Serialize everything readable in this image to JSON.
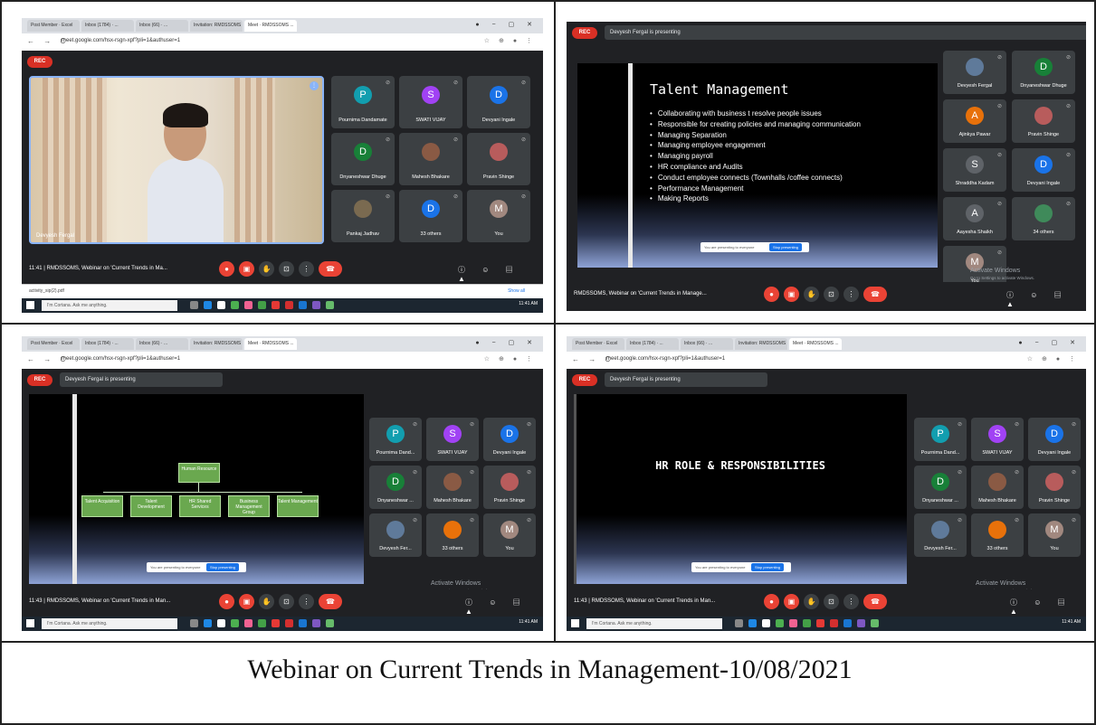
{
  "caption": "Webinar on Current Trends in Management-10/08/2021",
  "colors": {
    "rec": "#d93025",
    "tile_bg": "#3c4043",
    "meet_bg": "#202124",
    "org_box": "#6aa84f"
  },
  "browser": {
    "tabs": [
      "Post Member · Excel",
      "Inbox (1784) · ...",
      "Inbox (66) · ...",
      "Invitation: RMDSSOMS ...",
      "Meet · RMDSSOMS ..."
    ],
    "url": "meet.google.com/hsx-rsgn-xpf?pli=1&authuser=1"
  },
  "meet": {
    "rec_label": "REC",
    "presenting": "Devyesh Fergal is presenting",
    "meeting_title": "RMDSSOMS, Webinar on 'Current Trends in Manage...",
    "meeting_title_short": "RMDSSOMS, Webinar on 'Current Trends in Man...",
    "meeting_title_first": "RMDSSOMS, Webinar on 'Current Trends in Ma...",
    "time": "11:41",
    "time2": "11:43",
    "watermark_title": "Activate Windows",
    "watermark_sub": "Go to Settings to activate Windows.",
    "speaker_name": "Devyesh Fergal"
  },
  "panel1": {
    "participants": [
      {
        "initial": "P",
        "name": "Pournima Dandamate",
        "color": "#129eaf"
      },
      {
        "initial": "S",
        "name": "SWATI VIJAY",
        "color": "#a142f4"
      },
      {
        "initial": "D",
        "name": "Devyani Ingale",
        "color": "#1a73e8"
      },
      {
        "initial": "D",
        "name": "Dnyaneshwar Dhuge",
        "color": "#188038"
      },
      {
        "initial": "",
        "name": "Mahesh Bhakare",
        "color": "#8a5a44"
      },
      {
        "initial": "",
        "name": "Pravin Shinge",
        "color": "#b85c5c"
      },
      {
        "initial": "",
        "name": "Pankaj Jadhav",
        "color": "#7a6a50"
      },
      {
        "initial": "D",
        "name": "33 others",
        "color": "#1a73e8"
      },
      {
        "initial": "M",
        "name": "You",
        "color": "#a1887f"
      }
    ],
    "download_file": "activity_sip(2).pdf",
    "show_all": "Show all",
    "taskbar_search": "I'm Cortana. Ask me anything.",
    "tray_time": "11:41 AM"
  },
  "panel2": {
    "slide_title": "Talent Management",
    "bullets": [
      "Collaborating with business t resolve people issues",
      "Responsible for creating policies and managing communication",
      "Managing Separation",
      "Managing employee engagement",
      "Managing payroll",
      "HR compliance and Audits",
      "Conduct employee connects (Townhalls /coffee connects)",
      "Performance Management",
      "Making Reports"
    ],
    "stop_presenting_text": "You are presenting to everyone",
    "stop_button": "Stop presenting",
    "participants": [
      {
        "initial": "",
        "name": "Devyesh Fergal",
        "color": "#5f7a9a"
      },
      {
        "initial": "D",
        "name": "Dnyaneshwar Dhuge",
        "color": "#188038"
      },
      {
        "initial": "A",
        "name": "Ajinkya Pawar",
        "color": "#e8710a"
      },
      {
        "initial": "",
        "name": "Pravin Shinge",
        "color": "#b85c5c"
      },
      {
        "initial": "S",
        "name": "Shraddha Kadam",
        "color": "#5f6368"
      },
      {
        "initial": "D",
        "name": "Devyani Ingale",
        "color": "#1a73e8"
      },
      {
        "initial": "A",
        "name": "Aayesha Shaikh",
        "color": "#5f6368"
      },
      {
        "initial": "",
        "name": "34 others",
        "color": "#3f8a5a"
      },
      {
        "initial": "M",
        "name": "You",
        "color": "#a1887f"
      }
    ]
  },
  "panel3": {
    "org_top": "Human Resource",
    "org_children": [
      "Talent Acquisition",
      "Talent Development",
      "HR Shared Services",
      "Business Management Group",
      "Talent Management"
    ],
    "participants": [
      {
        "initial": "P",
        "name": "Pournima Dand...",
        "color": "#129eaf"
      },
      {
        "initial": "S",
        "name": "SWATI VIJAY",
        "color": "#a142f4"
      },
      {
        "initial": "D",
        "name": "Devyani Ingale",
        "color": "#1a73e8"
      },
      {
        "initial": "D",
        "name": "Dnyaneshwar ...",
        "color": "#188038"
      },
      {
        "initial": "",
        "name": "Mahesh Bhakare",
        "color": "#8a5a44"
      },
      {
        "initial": "",
        "name": "Pravin Shinge",
        "color": "#b85c5c"
      },
      {
        "initial": "",
        "name": "Devyesh Fer...",
        "color": "#5f7a9a"
      },
      {
        "initial": "",
        "name": "33 others",
        "color": "#e8710a"
      },
      {
        "initial": "M",
        "name": "You",
        "color": "#a1887f"
      }
    ]
  },
  "panel4": {
    "slide_title": "HR ROLE & RESPONSIBILITIES",
    "participants": [
      {
        "initial": "P",
        "name": "Pournima Dand...",
        "color": "#129eaf"
      },
      {
        "initial": "S",
        "name": "SWATI VIJAY",
        "color": "#a142f4"
      },
      {
        "initial": "D",
        "name": "Devyani Ingale",
        "color": "#1a73e8"
      },
      {
        "initial": "D",
        "name": "Dnyaneshwar ...",
        "color": "#188038"
      },
      {
        "initial": "",
        "name": "Mahesh Bhakare",
        "color": "#8a5a44"
      },
      {
        "initial": "",
        "name": "Pravin Shinge",
        "color": "#b85c5c"
      },
      {
        "initial": "",
        "name": "Devyesh Fer...",
        "color": "#5f7a9a"
      },
      {
        "initial": "",
        "name": "33 others",
        "color": "#e8710a"
      },
      {
        "initial": "M",
        "name": "You",
        "color": "#a1887f"
      }
    ]
  }
}
